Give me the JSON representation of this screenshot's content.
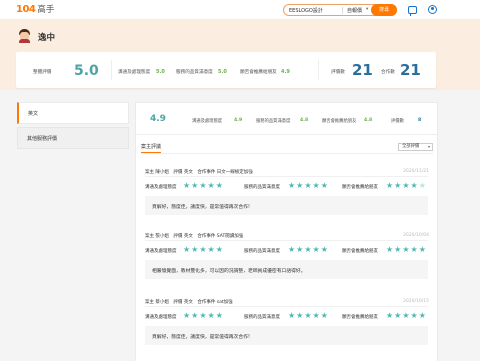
{
  "header": {
    "logo_num": "104",
    "logo_text": "高手",
    "search_value": "EESLOGO設計",
    "search_select": "自報價",
    "search_caret": "▾",
    "search_button": "搜尋"
  },
  "profile": {
    "name": "逸中"
  },
  "stats": {
    "overall_label": "整體評價",
    "overall_value": "5.0",
    "comm_label": "溝通及處理態度",
    "comm_value": "5.0",
    "service_label": "服務的品質滿意度",
    "service_value": "5.0",
    "recommend_label": "願否會推薦給朋友",
    "recommend_value": "4.9",
    "reviews_label": "評價數",
    "reviews_value": "21",
    "cases_label": "合作數",
    "cases_value": "21"
  },
  "sidebar": {
    "items": [
      {
        "label": "英文"
      },
      {
        "label": "其他服務評價"
      }
    ]
  },
  "summary": {
    "score": "4.9",
    "comm_label": "溝通及處理態度",
    "comm_value": "4.9",
    "service_label": "服務的品質滿意度",
    "service_value": "4.8",
    "recommend_label": "願否會推薦給朋友",
    "recommend_value": "4.8",
    "count_label": "評價數",
    "count_value": "8"
  },
  "filter": {
    "tab": "案主評議",
    "dropdown": "全部評價",
    "dropdown_arrow": "▾"
  },
  "reviews": [
    {
      "meta": "案主 陳小姐　評價 英文　合作事件 日文一線檢定加強",
      "date": "2020/11/21",
      "r1_label": "溝通及處理態度",
      "r2_label": "服務的品質滿意度",
      "r3_label": "願否會推薦給朋友",
      "comment": "頁解好，態度佳，議度快，是常值得再次合作!"
    },
    {
      "meta": "案主 張小姐　評價 英文　合作事件 SAT閱讀加強",
      "date": "2020/10/04",
      "r1_label": "溝通及處理態度",
      "r2_label": "服務的品質滿意度",
      "r3_label": "願否會推薦給朋友",
      "comment": "相嚴憶覺面，教材豐化多，可以因的況調整，老師員成優密有口語得好。"
    },
    {
      "meta": "案主 蔡小姐　評價 英文　合作事件 sat加強",
      "date": "2020/10/15",
      "r1_label": "溝通及處理態度",
      "r2_label": "服務的品質滿意度",
      "r3_label": "願否會推薦給朋友",
      "comment": "頁解好，態度佳，議度快，是常值得再次合作!"
    }
  ],
  "colors": {
    "brand": "#ff7800",
    "teal": "#4fa3a3",
    "blue": "#2a6f9b",
    "star": "#4fb8b0",
    "green_value": "#6ab04c"
  }
}
